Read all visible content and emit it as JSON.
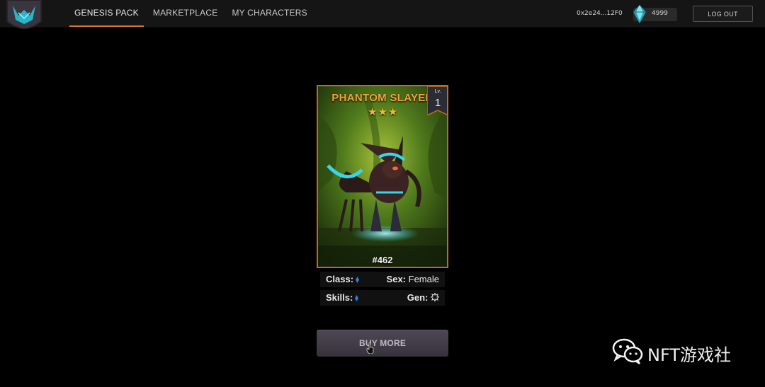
{
  "nav": {
    "items": [
      {
        "label": "GENESIS PACK",
        "active": true
      },
      {
        "label": "MARKETPLACE",
        "active": false
      },
      {
        "label": "MY CHARACTERS",
        "active": false
      }
    ]
  },
  "account": {
    "wallet": "0x2e24...12F0",
    "gems": "4999",
    "logout_label": "LOG OUT"
  },
  "card": {
    "name": "PHANTOM SLAYER",
    "stars": "★★★",
    "level_label": "Lv.",
    "level": "1",
    "id": "#462"
  },
  "attributes": {
    "class_label": "Class:",
    "sex_label": "Sex:",
    "sex_value": "Female",
    "skills_label": "Skills:",
    "gen_label": "Gen:"
  },
  "buy_more_label": "BUY MORE",
  "watermark": "NFT游戏社",
  "colors": {
    "accent": "#d9782a",
    "card_title": "#f3a23a",
    "diamond": "#2f7fe0"
  }
}
